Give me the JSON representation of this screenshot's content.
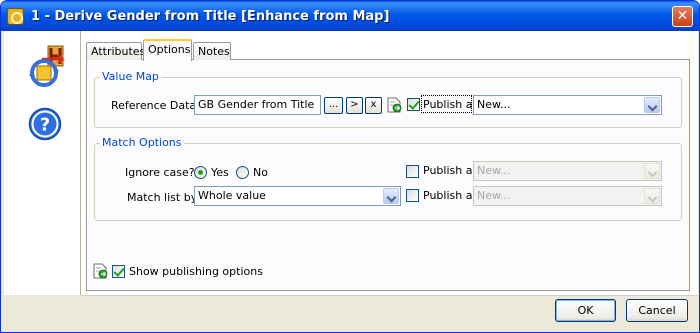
{
  "window": {
    "title": "1 - Derive Gender from Title [Enhance from Map]",
    "close_label": "✕",
    "accent_color": "#0054e3"
  },
  "tabs": [
    {
      "label": "Attributes",
      "active": false
    },
    {
      "label": "Options",
      "active": true
    },
    {
      "label": "Notes",
      "active": false
    }
  ],
  "value_map": {
    "group_label": "Value Map",
    "reference_data_label": "Reference Data",
    "reference_data_value": "GB Gender from Title",
    "browse_label": "...",
    "go_label": ">",
    "clear_label": "x",
    "publish_checked": true,
    "publish_label": "Publish as",
    "publish_value": "New..."
  },
  "match_options": {
    "group_label": "Match Options",
    "ignore_case_label": "Ignore case?",
    "yes_label": "Yes",
    "no_label": "No",
    "ignore_case_selected": "Yes",
    "match_list_by_label": "Match list by",
    "match_list_by_value": "Whole value",
    "publish_1_label": "Publish as",
    "publish_1_checked": false,
    "publish_1_value": "New...",
    "publish_2_label": "Publish as",
    "publish_2_checked": false,
    "publish_2_value": "New..."
  },
  "footer": {
    "show_publishing_label": "Show publishing options",
    "show_publishing_checked": true,
    "ok_label": "OK",
    "cancel_label": "Cancel"
  },
  "icons": {
    "app": "processor-icon",
    "help": "help-icon",
    "publish": "publish-icon"
  }
}
